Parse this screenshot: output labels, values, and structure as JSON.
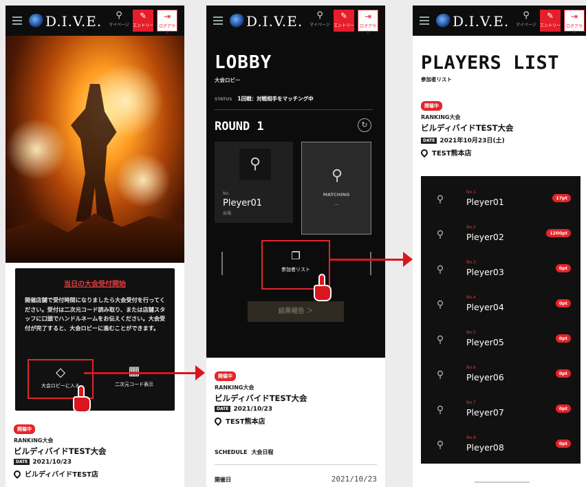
{
  "header": {
    "logo": "D.I.V.E.",
    "mypage_label": "マイページ",
    "entry_label": "エントリー",
    "logout_label": "ログアウト"
  },
  "screen1": {
    "notice_title": "当日の大会受付開始",
    "notice_body": "開催店舗で受付時間になりましたら大会受付を行ってください。受付は二次元コード読み取り、または店舗スタッフに口頭でハンドルネームをお伝えください。大会受付が完了すると、大会ロビーに進むことができます。",
    "lobby_button": "大会ロビーに入る",
    "qr_button": "二次元コード表示",
    "badge": "開催中",
    "event_type": "RANKING大会",
    "event_name": "ビルディバイドTEST大会",
    "date_tag": "DATE",
    "date": "2021/10/23",
    "venue": "ビルディバイドTEST店"
  },
  "screen2": {
    "title": "LOBBY",
    "subtitle": "大会ロビー",
    "status_key": "STATUS",
    "status_value": "1回戦：対戦相手をマッチング中",
    "round": "ROUND 1",
    "me_no": "No.",
    "me_name": "Pleyer01",
    "me_status": "出場",
    "opponent_status": "MATCHING",
    "opponent_dots": "...",
    "players_button": "参加者リスト",
    "report_button": "結果報告 ＞",
    "badge": "開催中",
    "event_type": "RANKING大会",
    "event_name": "ビルディバイドTEST大会",
    "date_tag": "DATE",
    "date": "2021/10/23",
    "venue": "TEST熊本店",
    "schedule_label": "SCHEDULE",
    "schedule_value": "大会日程",
    "held_label": "開催日",
    "held_value": "2021/10/23"
  },
  "screen3": {
    "title": "PLAYERS LIST",
    "subtitle": "参加者リスト",
    "badge": "開催中",
    "event_type": "RANKING大会",
    "event_name": "ビルディバイドTEST大会",
    "date_tag": "DATE",
    "date": "2021年10月23日(土)",
    "venue": "TEST熊本店",
    "players": [
      {
        "no": "No.1",
        "name": "Pleyer01",
        "pt": "17pt"
      },
      {
        "no": "No.2",
        "name": "Pleyer02",
        "pt": "1200pt"
      },
      {
        "no": "No.3",
        "name": "Pleyer03",
        "pt": "0pt"
      },
      {
        "no": "No.4",
        "name": "Pleyer04",
        "pt": "0pt"
      },
      {
        "no": "No.5",
        "name": "Pleyer05",
        "pt": "0pt"
      },
      {
        "no": "No.6",
        "name": "Pleyer06",
        "pt": "0pt"
      },
      {
        "no": "No.7",
        "name": "Pleyer07",
        "pt": "0pt"
      },
      {
        "no": "No.8",
        "name": "Pleyer08",
        "pt": "0pt"
      }
    ]
  },
  "colors": {
    "accent": "#e4252a",
    "dark": "#111111"
  },
  "icons": [
    "menu-icon",
    "user-icon",
    "pencil-icon",
    "logout-icon",
    "diamond-icon",
    "qr-code-icon",
    "refresh-icon",
    "copy-icon",
    "location-pin-icon",
    "pointing-hand-icon",
    "arrow-right-icon"
  ]
}
